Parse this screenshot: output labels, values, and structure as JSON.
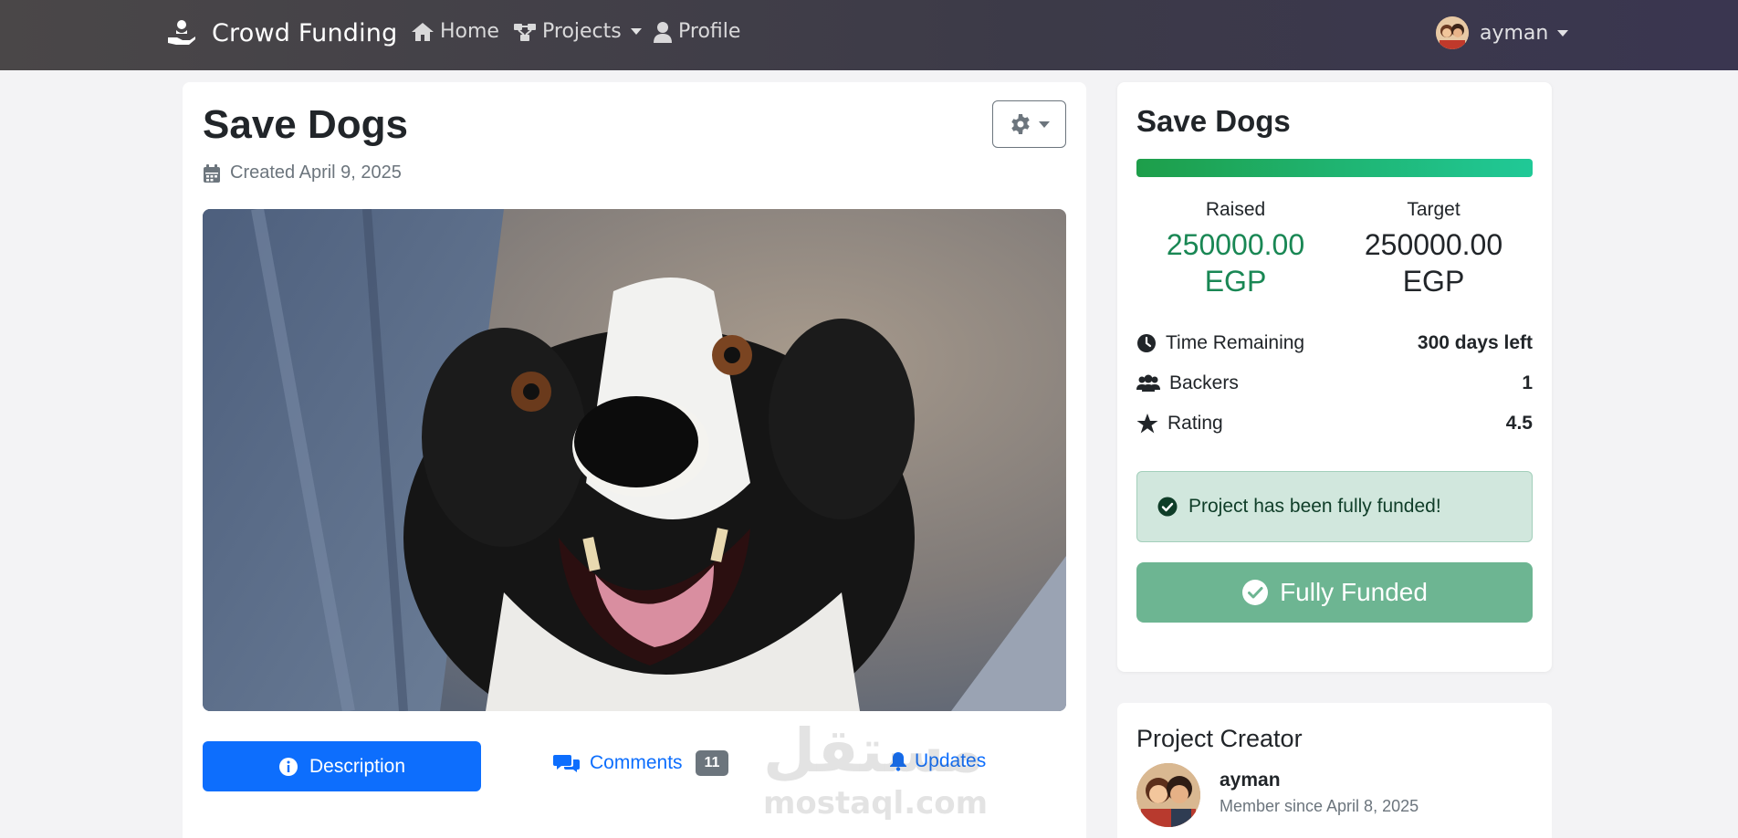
{
  "navbar": {
    "brand": "Crowd Funding",
    "links": [
      {
        "label": "Home",
        "icon": "home-icon"
      },
      {
        "label": "Projects",
        "icon": "projects-icon",
        "dropdown": true
      },
      {
        "label": "Profile",
        "icon": "user-icon"
      }
    ],
    "user": {
      "name": "ayman"
    }
  },
  "project": {
    "title": "Save Dogs",
    "created": "Created April 9, 2025",
    "tabs": {
      "description": "Description",
      "comments": "Comments",
      "comments_count": "11",
      "updates": "Updates"
    }
  },
  "summary": {
    "title": "Save Dogs",
    "progress_percent": 100,
    "raised_label": "Raised",
    "raised_amount": "250000.00",
    "raised_currency": "EGP",
    "target_label": "Target",
    "target_amount": "250000.00",
    "target_currency": "EGP",
    "time_label": "Time Remaining",
    "time_value": "300 days left",
    "backers_label": "Backers",
    "backers_value": "1",
    "rating_label": "Rating",
    "rating_value": "4.5",
    "alert": "Project has been fully funded!",
    "button": "Fully Funded"
  },
  "creator": {
    "heading": "Project Creator",
    "name": "ayman",
    "since": "Member since April 8, 2025"
  },
  "watermark": {
    "arabic": "مستقل",
    "latin": "mostaql.com"
  },
  "colors": {
    "primary": "#0d6efd",
    "success": "#198754",
    "navbar": "#3c3a48",
    "funded_button": "#6db592"
  }
}
